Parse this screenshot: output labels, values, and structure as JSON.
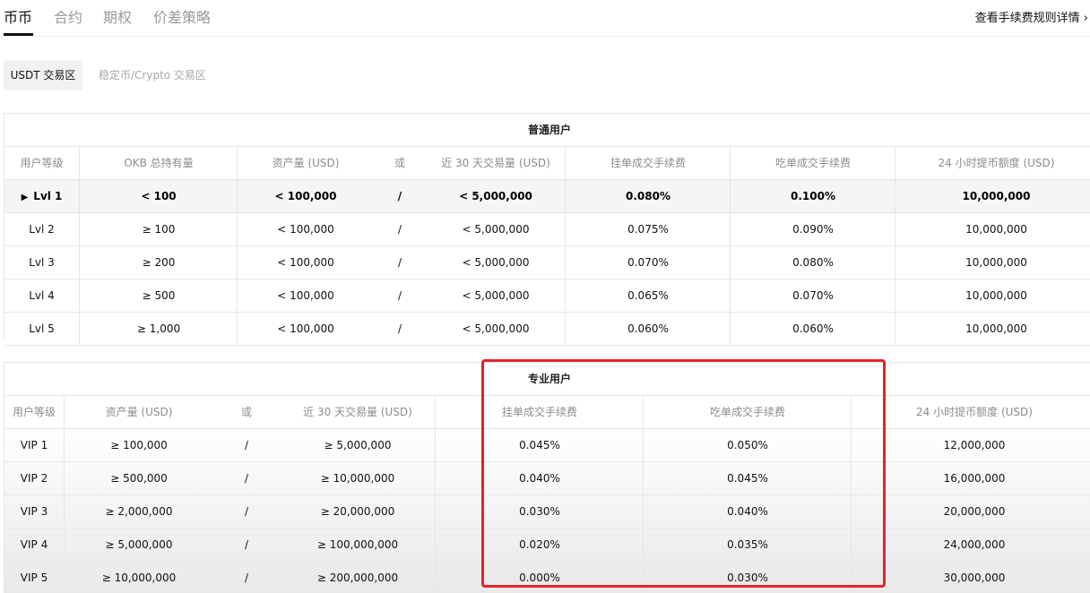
{
  "tabs": [
    {
      "label": "币币",
      "active": true
    },
    {
      "label": "合约",
      "active": false
    },
    {
      "label": "期权",
      "active": false
    },
    {
      "label": "价差策略",
      "active": false
    }
  ],
  "rules_link": "查看手续费规则详情 ›",
  "subtabs": [
    {
      "label": "USDT 交易区",
      "active": true
    },
    {
      "label": "稳定币/Crypto 交易区",
      "active": false
    }
  ],
  "regular": {
    "title": "普通用户",
    "headers": [
      "用户等级",
      "OKB 总持有量",
      "资产量 (USD)",
      "或",
      "近 30 天交易量 (USD)",
      "挂单成交手续费",
      "吃单成交手续费",
      "24 小时提币额度 (USD)"
    ],
    "rows": [
      {
        "level": "Lvl 1",
        "okb": "< 100",
        "assets": "< 100,000",
        "or": "/",
        "volume": "< 5,000,000",
        "maker": "0.080%",
        "taker": "0.100%",
        "withdraw": "10,000,000"
      },
      {
        "level": "Lvl 2",
        "okb": "≥ 100",
        "assets": "< 100,000",
        "or": "/",
        "volume": "< 5,000,000",
        "maker": "0.075%",
        "taker": "0.090%",
        "withdraw": "10,000,000"
      },
      {
        "level": "Lvl 3",
        "okb": "≥ 200",
        "assets": "< 100,000",
        "or": "/",
        "volume": "< 5,000,000",
        "maker": "0.070%",
        "taker": "0.080%",
        "withdraw": "10,000,000"
      },
      {
        "level": "Lvl 4",
        "okb": "≥ 500",
        "assets": "< 100,000",
        "or": "/",
        "volume": "< 5,000,000",
        "maker": "0.065%",
        "taker": "0.070%",
        "withdraw": "10,000,000"
      },
      {
        "level": "Lvl 5",
        "okb": "≥ 1,000",
        "assets": "< 100,000",
        "or": "/",
        "volume": "< 5,000,000",
        "maker": "0.060%",
        "taker": "0.060%",
        "withdraw": "10,000,000"
      }
    ]
  },
  "pro": {
    "title": "专业用户",
    "headers": [
      "用户等级",
      "资产量 (USD)",
      "或",
      "近 30 天交易量 (USD)",
      "挂单成交手续费",
      "吃单成交手续费",
      "24 小时提币额度 (USD)"
    ],
    "rows": [
      {
        "level": "VIP 1",
        "assets": "≥ 100,000",
        "or": "/",
        "volume": "≥ 5,000,000",
        "maker": "0.045%",
        "taker": "0.050%",
        "withdraw": "12,000,000"
      },
      {
        "level": "VIP 2",
        "assets": "≥ 500,000",
        "or": "/",
        "volume": "≥ 10,000,000",
        "maker": "0.040%",
        "taker": "0.045%",
        "withdraw": "16,000,000"
      },
      {
        "level": "VIP 3",
        "assets": "≥ 2,000,000",
        "or": "/",
        "volume": "≥ 20,000,000",
        "maker": "0.030%",
        "taker": "0.040%",
        "withdraw": "20,000,000"
      },
      {
        "level": "VIP 4",
        "assets": "≥ 5,000,000",
        "or": "/",
        "volume": "≥ 100,000,000",
        "maker": "0.020%",
        "taker": "0.035%",
        "withdraw": "24,000,000"
      },
      {
        "level": "VIP 5",
        "assets": "≥ 10,000,000",
        "or": "/",
        "volume": "≥ 200,000,000",
        "maker": "0.000%",
        "taker": "0.030%",
        "withdraw": "30,000,000"
      }
    ]
  },
  "colors": {
    "highlight": "#e3232a",
    "selected_row": "#f5f5f5"
  }
}
